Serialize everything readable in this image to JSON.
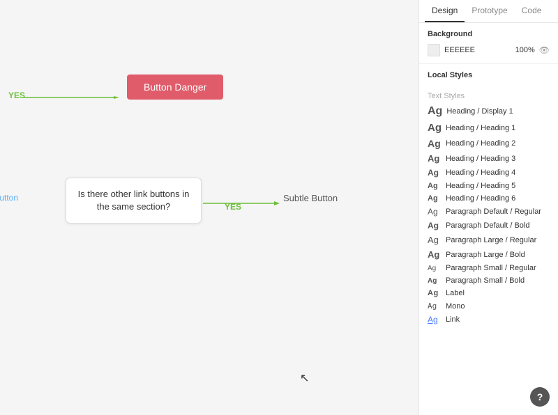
{
  "tabs": {
    "design": "Design",
    "prototype": "Prototype",
    "code": "Code"
  },
  "background": {
    "label": "Background",
    "hex": "EEEEEE",
    "opacity": "100%"
  },
  "local_styles": {
    "label": "Local Styles",
    "text_styles_label": "Text Styles",
    "items": [
      {
        "id": "heading-display",
        "ag": "Ag",
        "name": "Heading / Display 1",
        "class": "display"
      },
      {
        "id": "heading-h1",
        "ag": "Ag",
        "name": "Heading / Heading 1",
        "class": "h1"
      },
      {
        "id": "heading-h2",
        "ag": "Ag",
        "name": "Heading / Heading 2",
        "class": "h2"
      },
      {
        "id": "heading-h3",
        "ag": "Ag",
        "name": "Heading / Heading 3",
        "class": "h3"
      },
      {
        "id": "heading-h4",
        "ag": "Ag",
        "name": "Heading / Heading 4",
        "class": "h4"
      },
      {
        "id": "heading-h5",
        "ag": "Ag",
        "name": "Heading / Heading 5",
        "class": "h5"
      },
      {
        "id": "heading-h6",
        "ag": "Ag",
        "name": "Heading / Heading 6",
        "class": "h6"
      },
      {
        "id": "para-default-regular",
        "ag": "Ag",
        "name": "Paragraph Default / Regular",
        "class": "para-default"
      },
      {
        "id": "para-default-bold",
        "ag": "Ag",
        "name": "Paragraph Default / Bold",
        "class": "para-default-bold"
      },
      {
        "id": "para-large-regular",
        "ag": "Ag",
        "name": "Paragraph Large / Regular",
        "class": "para-large"
      },
      {
        "id": "para-large-bold",
        "ag": "Ag",
        "name": "Paragraph Large / Bold",
        "class": "para-large-bold"
      },
      {
        "id": "para-small-regular",
        "ag": "Ag",
        "name": "Paragraph Small / Regular",
        "class": "para-small"
      },
      {
        "id": "para-small-bold",
        "ag": "Ag",
        "name": "Paragraph Small / Bold",
        "class": "para-small-bold"
      },
      {
        "id": "label",
        "ag": "Ag",
        "name": "Label",
        "class": "label"
      },
      {
        "id": "mono",
        "ag": "Ag",
        "name": "Mono",
        "class": "mono"
      },
      {
        "id": "link",
        "ag": "Ag",
        "name": "Link",
        "class": "link"
      }
    ]
  },
  "canvas": {
    "button_danger_label": "Button Danger",
    "yes_label": "YES",
    "yes2_label": "YES",
    "question_text": "Is there other link buttons in the same section?",
    "link_button_label": "k Button",
    "subtle_button_label": "Subtle Button"
  },
  "help_button": "?"
}
